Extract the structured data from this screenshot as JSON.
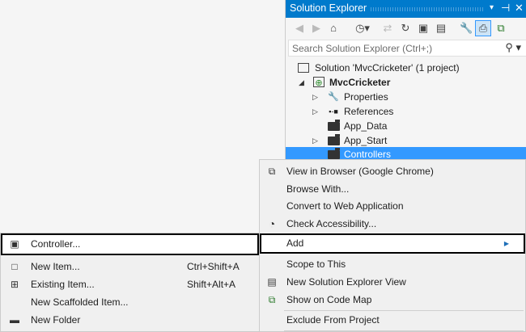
{
  "solution_explorer": {
    "title": "Solution Explorer",
    "controls": {
      "dropdown": "▾",
      "pin": "⊣",
      "close": "✕"
    },
    "toolbar": [
      "back-icon",
      "forward-icon",
      "home-icon",
      "pending-changes-icon",
      "sync-icon",
      "refresh-icon",
      "collapse-all-icon",
      "show-all-files-icon",
      "properties-icon",
      "preview-selected-icon",
      "code-map-icon"
    ],
    "search_placeholder": "Search Solution Explorer (Ctrl+;)",
    "tree": [
      {
        "label": "Solution 'MvcCricketer' (1 project)"
      },
      {
        "label": "MvcCricketer",
        "bold": true
      },
      {
        "label": "Properties"
      },
      {
        "label": "References"
      },
      {
        "label": "App_Data"
      },
      {
        "label": "App_Start"
      },
      {
        "label": "Controllers",
        "selected": true
      }
    ]
  },
  "context_menu": {
    "items": [
      {
        "label": "View in Browser (Google Chrome)"
      },
      {
        "label": "Browse With..."
      },
      {
        "label": "Convert to Web Application"
      },
      {
        "label": "Check Accessibility..."
      },
      {
        "label": "Add",
        "highlighted": true
      },
      {
        "label": "Scope to This"
      },
      {
        "label": "New Solution Explorer View"
      },
      {
        "label": "Show on Code Map"
      },
      {
        "label": "Exclude From Project"
      }
    ]
  },
  "add_submenu": {
    "items": [
      {
        "label": "Controller...",
        "highlighted": true
      },
      {
        "label": "New Item...",
        "shortcut": "Ctrl+Shift+A"
      },
      {
        "label": "Existing Item...",
        "shortcut": "Shift+Alt+A"
      },
      {
        "label": "New Scaffolded Item..."
      },
      {
        "label": "New Folder"
      }
    ]
  },
  "colors": {
    "accent": "#007acc",
    "selection": "#3399ff",
    "menu_bg": "#f0f0f0"
  }
}
